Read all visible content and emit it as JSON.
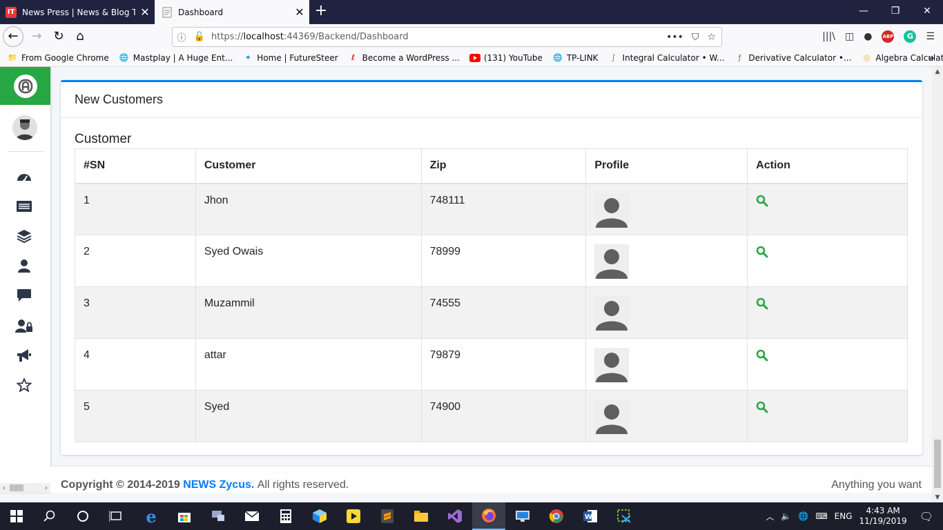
{
  "browser": {
    "tabs": [
      {
        "title": "News Press | News & Blog Tem",
        "active": false
      },
      {
        "title": "Dashboard",
        "active": true
      }
    ],
    "url_prefix": "https://",
    "url_host": "localhost",
    "url_path": ":44369/Backend/Dashboard",
    "bookmarks": [
      {
        "label": "From Google Chrome",
        "icon": "folder-icon"
      },
      {
        "label": "Mastplay | A Huge Ent...",
        "icon": "globe-icon"
      },
      {
        "label": "Home | FutureSteer",
        "icon": "futuresteer-icon"
      },
      {
        "label": "Become a WordPress ...",
        "icon": "wordpress-icon"
      },
      {
        "label": "(131) YouTube",
        "icon": "youtube-icon"
      },
      {
        "label": "TP-LINK",
        "icon": "globe-icon"
      },
      {
        "label": "Integral Calculator • W...",
        "icon": "calculator-icon"
      },
      {
        "label": "Derivative Calculator •...",
        "icon": "calculator-icon"
      },
      {
        "label": "Algebra Calculator - ...",
        "icon": "algebra-icon"
      }
    ]
  },
  "sidebar": {
    "brand_letter": "A",
    "items": [
      {
        "name": "dashboard"
      },
      {
        "name": "list"
      },
      {
        "name": "layers"
      },
      {
        "name": "user"
      },
      {
        "name": "comment"
      },
      {
        "name": "user-lock"
      },
      {
        "name": "bullhorn"
      },
      {
        "name": "star"
      }
    ]
  },
  "card": {
    "title": "New Customers",
    "caption": "Customer",
    "columns": [
      "#SN",
      "Customer",
      "Zip",
      "Profile",
      "Action"
    ],
    "rows": [
      {
        "sn": "1",
        "customer": "Jhon",
        "zip": "748111"
      },
      {
        "sn": "2",
        "customer": "Syed Owais",
        "zip": "78999"
      },
      {
        "sn": "3",
        "customer": "Muzammil",
        "zip": "74555"
      },
      {
        "sn": "4",
        "customer": "attar",
        "zip": "79879"
      },
      {
        "sn": "5",
        "customer": "Syed",
        "zip": "74900"
      }
    ]
  },
  "footer": {
    "copyright": "Copyright © 2014-2019",
    "brand": "NEWS Zycus.",
    "rights": "All rights reserved.",
    "right_text": "Anything you want"
  },
  "taskbar": {
    "language": "ENG",
    "time": "4:43 AM",
    "date": "11/19/2019"
  },
  "colors": {
    "accent": "#007bff",
    "brand_green": "#28a745",
    "action_icon": "#28a745"
  }
}
